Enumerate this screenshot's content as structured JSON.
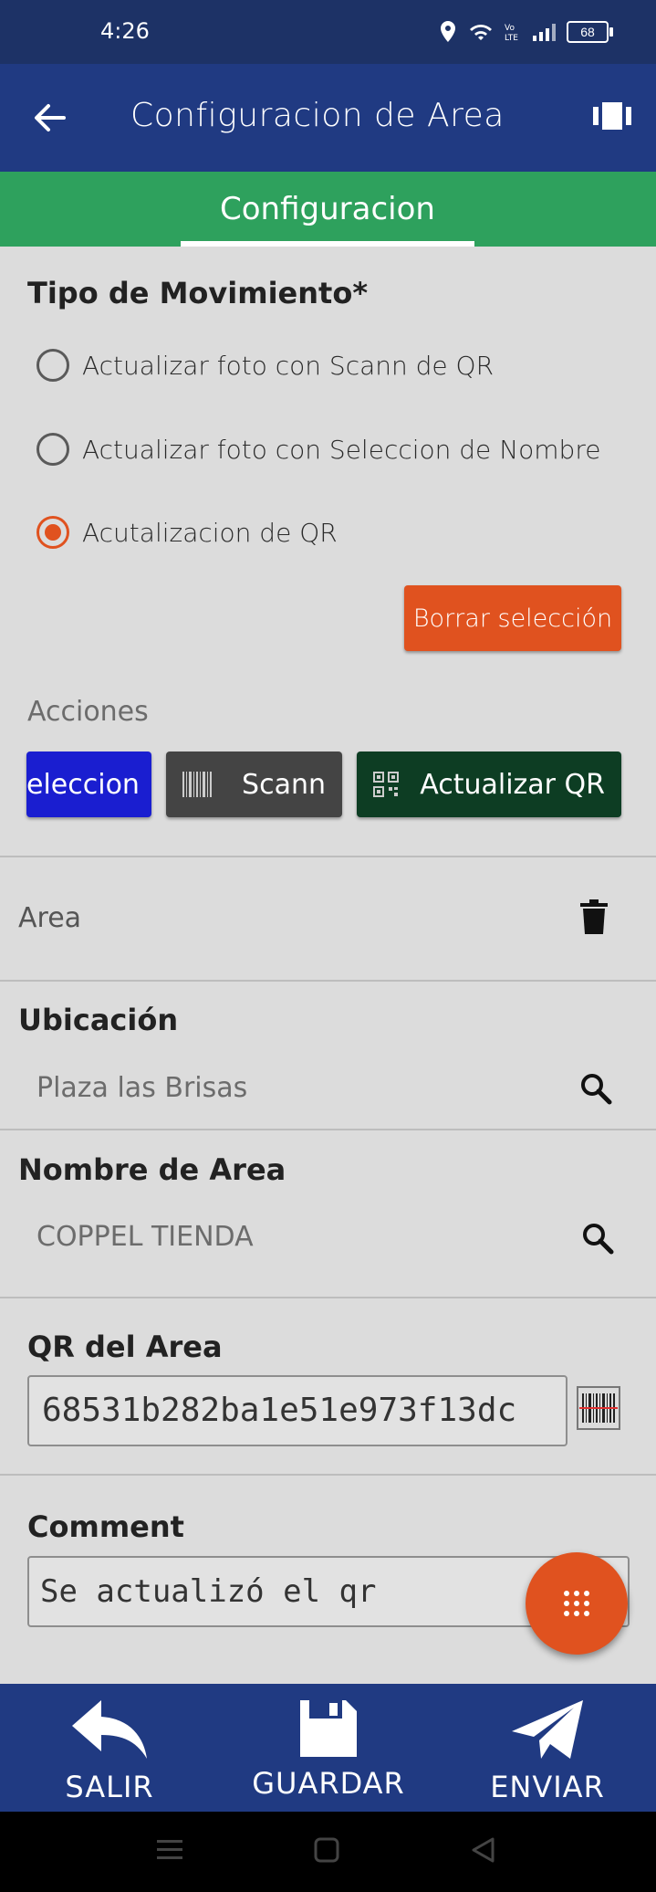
{
  "status_bar": {
    "time": "4:26",
    "battery": "68"
  },
  "app_bar": {
    "title": "Configuracion de Area"
  },
  "tabs": [
    {
      "label": "Configuracion",
      "selected": true
    }
  ],
  "movement": {
    "title": "Tipo de Movimiento*",
    "options": [
      {
        "label": "Actualizar foto con Scann de QR",
        "selected": false
      },
      {
        "label": "Actualizar foto con Seleccion de Nombre",
        "selected": false
      },
      {
        "label": "Acutalizacion de QR",
        "selected": true
      }
    ],
    "clear_label": "Borrar selección"
  },
  "actions": {
    "title": "Acciones",
    "buttons": [
      {
        "label": "eleccion",
        "color": "#1a1ed0"
      },
      {
        "label": "Scann",
        "color": "#444444"
      },
      {
        "label": "Actualizar QR",
        "color": "#0d3d23"
      }
    ]
  },
  "area": {
    "label": "Area"
  },
  "ubicacion": {
    "label": "Ubicación",
    "value": "Plaza las Brisas"
  },
  "nombre_area": {
    "label": "Nombre de Area",
    "value": "COPPEL TIENDA"
  },
  "qr_area": {
    "label": "QR del Area",
    "value": "68531b282ba1e51e973f13dc"
  },
  "comment": {
    "label": "Comment",
    "value": "Se actualizó el qr"
  },
  "bottom_nav": {
    "exit": "SALIR",
    "save": "GUARDAR",
    "send": "ENVIAR"
  },
  "colors": {
    "primary": "#203a82",
    "accent": "#e0521f",
    "tab_green": "#2ea15d"
  }
}
